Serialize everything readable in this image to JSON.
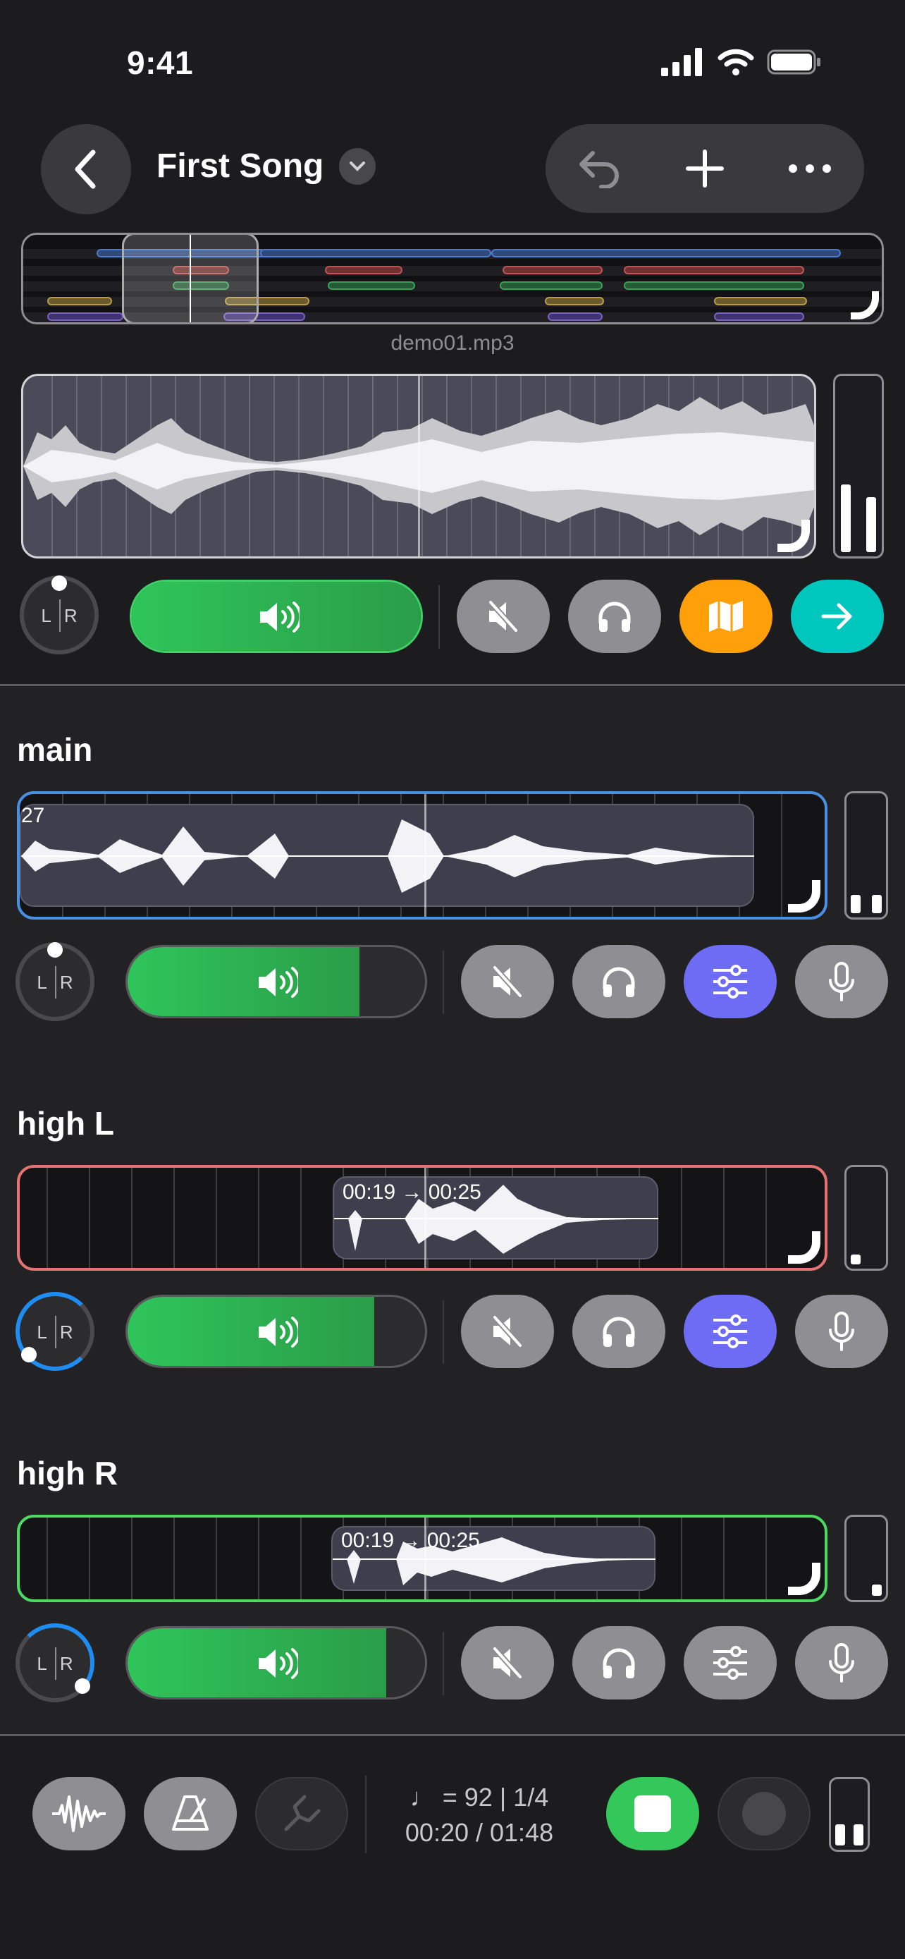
{
  "status": {
    "time": "9:41"
  },
  "header": {
    "title": "First Song"
  },
  "overview": {
    "filename": "demo01.mp3"
  },
  "tracks": [
    {
      "name": "main",
      "clip_label": "27",
      "volume": 0.78,
      "pan": 0.0,
      "eq_active": true
    },
    {
      "name": "high L",
      "clip_label": "00:19 → 00:25",
      "volume": 0.83,
      "pan": -1.0,
      "eq_active": true
    },
    {
      "name": "high R",
      "clip_label": "00:19 → 00:25",
      "volume": 0.87,
      "pan": 1.0,
      "eq_active": false
    }
  ],
  "master": {
    "volume": 1.0,
    "pan": 0.0
  },
  "transport": {
    "tempo": "♩ = 92 | 1/4",
    "time": "00:20 / 01:48"
  },
  "colors": {
    "green": "#34c759",
    "orange": "#ff9f0a",
    "teal": "#00c7be",
    "eq_blue": "#6e6cf5",
    "main_border": "#4a90e2",
    "highL_border": "#e57373",
    "highR_border": "#4cd964"
  }
}
